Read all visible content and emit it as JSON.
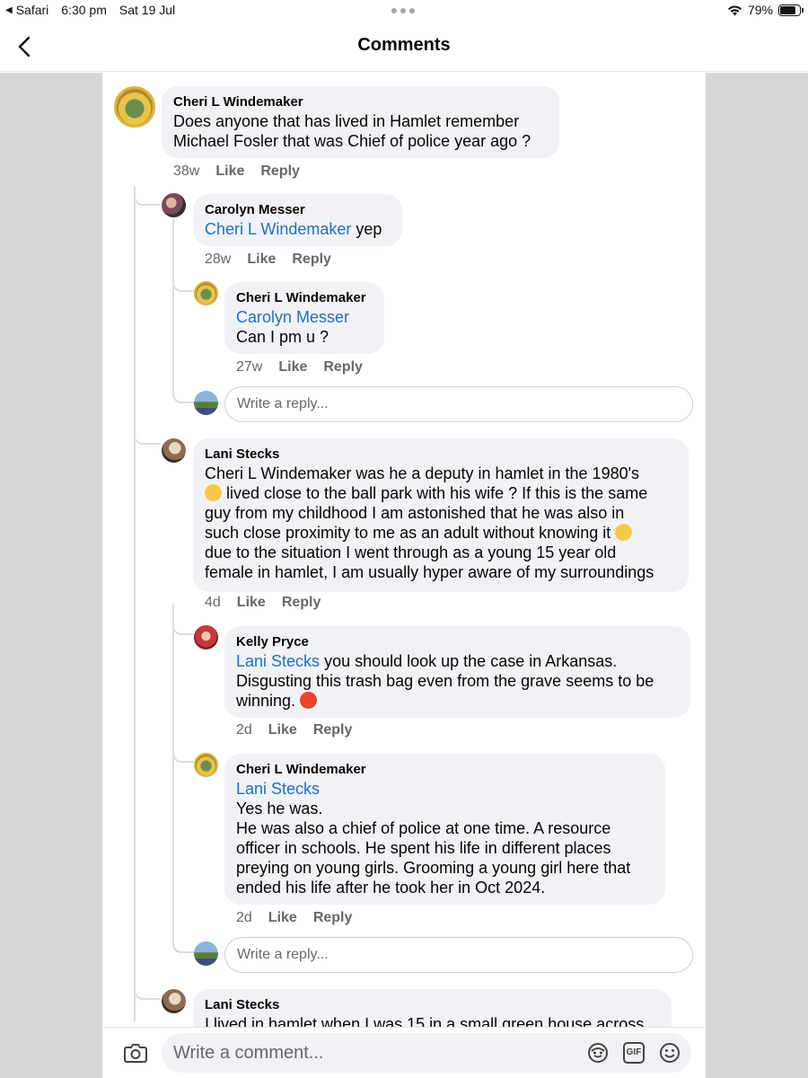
{
  "status_bar": {
    "back_app": "Safari",
    "time": "6:30 pm",
    "date": "Sat 19 Jul",
    "battery": "79%",
    "battery_level": 0.79
  },
  "header": {
    "title": "Comments"
  },
  "comments": [
    {
      "author": "Cheri L Windemaker",
      "lines": [
        "Does anyone that has lived in Hamlet remember",
        "Michael Fosler that was Chief of police year ago ?"
      ],
      "time": "38w",
      "like": "Like",
      "reply": "Reply"
    },
    {
      "author": "Carolyn Messer",
      "mention": "Cheri L Windemaker",
      "text": " yep",
      "time": "28w",
      "like": "Like",
      "reply": "Reply"
    },
    {
      "author": "Cheri L Windemaker",
      "mention": "Carolyn Messer",
      "text": "Can I pm u ?",
      "time": "27w",
      "like": "Like",
      "reply": "Reply"
    },
    {
      "author": "Lani Stecks",
      "lines": [
        "Cheri L Windemaker was he a deputy in hamlet in the 1980's",
        " lived close to the ball park with his wife ? If this is the same",
        "guy from my childhood I am astonished that he was also in",
        "such close proximity to me as an adult without knowing it ",
        "due to the situation I went through as a young 15 year old",
        "female in hamlet, I am usually hyper aware of my surroundings"
      ],
      "time": "4d",
      "like": "Like",
      "reply": "Reply"
    },
    {
      "author": "Kelly Pryce",
      "mention": "Lani Stecks",
      "lines": [
        " you should look up the case in Arkansas.",
        "Disgusting this trash bag even from the grave seems to be",
        "winning. "
      ],
      "time": "2d",
      "like": "Like",
      "reply": "Reply"
    },
    {
      "author": "Cheri L Windemaker",
      "mention": "Lani Stecks",
      "lines": [
        "Yes he was.",
        "He was also a chief of police at one time. A resource",
        "officer in schools. He spent his life in different places",
        "preying on young girls. Grooming a young girl here that",
        "ended his life after he took her in Oct 2024."
      ],
      "time": "2d",
      "like": "Like",
      "reply": "Reply"
    },
    {
      "author": "Lani Stecks",
      "lines": [
        "I lived in hamlet when I was 15 in a small green house across"
      ]
    }
  ],
  "reply_placeholder": "Write a reply...",
  "composer": {
    "placeholder": "Write a comment...",
    "gif_label": "GIF"
  },
  "icons": [
    "chevron-left-icon",
    "wifi-icon",
    "battery-icon",
    "camera-icon",
    "avatar-sticker-icon",
    "gif-icon",
    "smiley-icon",
    "neutral-face-emoji",
    "pensive-face-emoji",
    "angry-face-emoji"
  ]
}
